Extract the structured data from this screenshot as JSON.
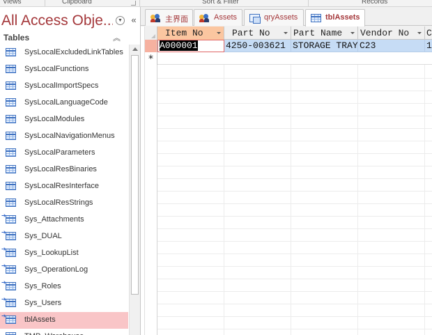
{
  "ribbon_groups": [
    "Views",
    "Clipboard",
    "Sort & Filter",
    "Records"
  ],
  "nav_pane": {
    "title": "All Access Obje...",
    "menu_icon": "chevron-down-circle-icon",
    "collapse_icon": "double-chevron-left-icon",
    "group_label": "Tables",
    "group_collapse_icon": "double-chevron-up-icon",
    "items": [
      {
        "label": "SysLocalExcludedLinkTables",
        "linked": false,
        "selected": false
      },
      {
        "label": "SysLocalFunctions",
        "linked": false,
        "selected": false
      },
      {
        "label": "SysLocalImportSpecs",
        "linked": false,
        "selected": false
      },
      {
        "label": "SysLocalLanguageCode",
        "linked": false,
        "selected": false
      },
      {
        "label": "SysLocalModules",
        "linked": false,
        "selected": false
      },
      {
        "label": "SysLocalNavigationMenus",
        "linked": false,
        "selected": false
      },
      {
        "label": "SysLocalParameters",
        "linked": false,
        "selected": false
      },
      {
        "label": "SysLocalResBinaries",
        "linked": false,
        "selected": false
      },
      {
        "label": "SysLocalResInterface",
        "linked": false,
        "selected": false
      },
      {
        "label": "SysLocalResStrings",
        "linked": false,
        "selected": false
      },
      {
        "label": "Sys_Attachments",
        "linked": true,
        "selected": false
      },
      {
        "label": "Sys_DUAL",
        "linked": true,
        "selected": false
      },
      {
        "label": "Sys_LookupList",
        "linked": true,
        "selected": false
      },
      {
        "label": "Sys_OperationLog",
        "linked": true,
        "selected": false
      },
      {
        "label": "Sys_Roles",
        "linked": true,
        "selected": false
      },
      {
        "label": "Sys_Users",
        "linked": true,
        "selected": false
      },
      {
        "label": "tblAssets",
        "linked": true,
        "selected": true
      },
      {
        "label": "TMP_Warehouse",
        "linked": false,
        "selected": false
      }
    ]
  },
  "tabs": [
    {
      "label": "主界面",
      "icon": "form-people-icon",
      "active": false
    },
    {
      "label": "Assets",
      "icon": "form-people-icon",
      "active": false
    },
    {
      "label": "qryAssets",
      "icon": "query-icon",
      "active": false
    },
    {
      "label": "tblAssets",
      "icon": "table-icon",
      "active": true
    }
  ],
  "datasheet": {
    "columns": [
      "Item No",
      "Part No",
      "Part Name",
      "Vendor No",
      "C"
    ],
    "rows": [
      [
        "A000001",
        "4250-003621",
        "STORAGE TRAY",
        "C23",
        "1"
      ]
    ],
    "new_row_marker": "*"
  },
  "colors": {
    "accent": "#a4373a",
    "selected_nav": "#f9c5c7",
    "selected_row": "#c6dcf5",
    "active_header": "#fbc6a0"
  }
}
